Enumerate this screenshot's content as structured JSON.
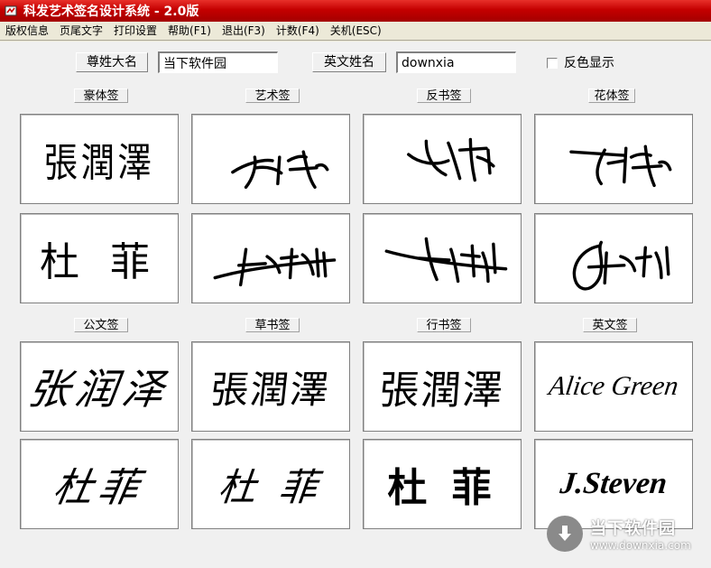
{
  "window": {
    "title": "科发艺术签名设计系统 - 2.0版"
  },
  "menu": [
    {
      "label": "版权信息"
    },
    {
      "label": "页尾文字"
    },
    {
      "label": "打印设置"
    },
    {
      "label": "帮助(F1)"
    },
    {
      "label": "退出(F3)"
    },
    {
      "label": "计数(F4)"
    },
    {
      "label": "关机(ESC)"
    }
  ],
  "form": {
    "chinese_name_label": "尊姓大名",
    "chinese_name_value": "当下软件园",
    "english_name_label": "英文姓名",
    "english_name_value": "downxia",
    "invert_color_label": "反色显示",
    "invert_color_checked": false
  },
  "categories": {
    "haoti": "豪体签",
    "yishu": "艺术签",
    "fanshu": "反书签",
    "huati": "花体签",
    "gongwen": "公文签",
    "caoshu": "草书签",
    "xingshu": "行书签",
    "yingwen": "英文签"
  },
  "signatures": {
    "haoti_1": "張潤澤",
    "haoti_2": "杜 菲",
    "gongwen_1": "张润泽",
    "gongwen_2": "杜菲",
    "caoshu_1": "張潤澤",
    "caoshu_2": "杜 菲",
    "xingshu_1": "張潤澤",
    "xingshu_2": "杜 菲",
    "yingwen_1": "Alice Green",
    "yingwen_2": "J.Steven"
  },
  "watermark": {
    "title": "当下软件园",
    "url": "www.downxia.com"
  }
}
